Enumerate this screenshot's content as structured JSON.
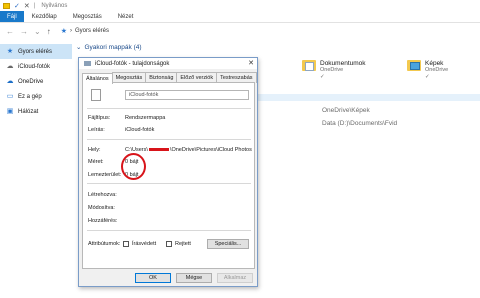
{
  "explorer": {
    "title": "Nyilvános",
    "ribbon_tabs": [
      "Fájl",
      "Kezdőlap",
      "Megosztás",
      "Nézet"
    ],
    "address": "Gyors elérés",
    "nav": {
      "back": "←",
      "forward": "→",
      "recent": "⌄",
      "up": "↑"
    },
    "sidebar": [
      {
        "label": "Gyors elérés",
        "icon": "star-icon"
      },
      {
        "label": "iCloud-fotók",
        "icon": "cloud-icon"
      },
      {
        "label": "OneDrive",
        "icon": "onedrive-icon"
      },
      {
        "label": "Ez a gép",
        "icon": "computer-icon"
      },
      {
        "label": "Hálózat",
        "icon": "network-icon"
      }
    ],
    "section_header": "Gyakori mappák (4)",
    "tiles": [
      {
        "name": "Dokumentumok",
        "sub": "OneDrive",
        "pin": "✓"
      },
      {
        "name": "Képek",
        "sub": "OneDrive",
        "pin": "✓"
      }
    ],
    "recent_paths": [
      "OneDrive\\Képek",
      "Data (D:)\\Documents\\Fvid"
    ]
  },
  "dialog": {
    "title": "iCloud-fotók - tulajdonságok",
    "close": "✕",
    "tabs": [
      "Általános",
      "Megosztás",
      "Biztonság",
      "Előző verziók",
      "Testreszabás"
    ],
    "active_tab": "Általános",
    "name_value": "iCloud-fotók",
    "fields": {
      "type_label": "Fájltípus:",
      "type_value": "Rendszermappa",
      "desc_label": "Leírás:",
      "desc_value": "iCloud-fotók",
      "loc_label": "Hely:",
      "loc_value_prefix": "C:\\Users\\",
      "loc_value_suffix": "\\OneDrive\\Pictures\\iCloud Photos",
      "size_label": "Méret:",
      "size_value": "0 bájt",
      "disk_label": "Lemezterület:",
      "disk_value": "0 bájt",
      "created_label": "Létrehozva:",
      "modified_label": "Módosítva:",
      "accessed_label": "Hozzáférés:",
      "attr_label": "Attribútumok:",
      "readonly_label": "Írásvédett",
      "hidden_label": "Rejtett",
      "special_button": "Speciális..."
    },
    "buttons": {
      "ok": "OK",
      "cancel": "Mégse",
      "apply": "Alkalmaz"
    },
    "highlight_color": "#d8141a"
  }
}
